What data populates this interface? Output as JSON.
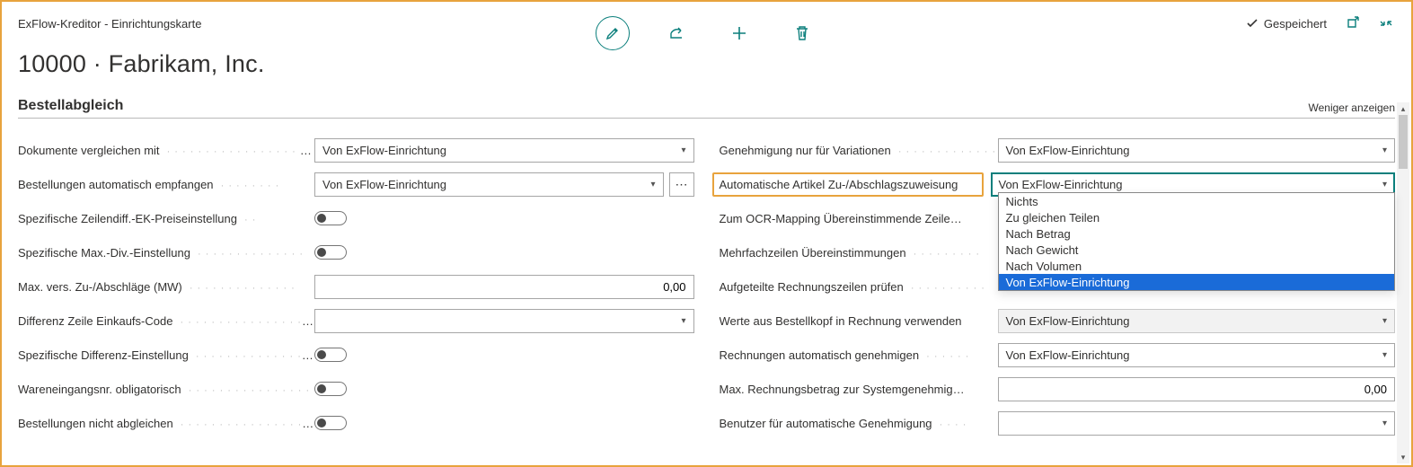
{
  "colors": {
    "accent": "#0b7f7c",
    "highlight": "#e8a33d",
    "selection": "#1a6bd8"
  },
  "header": {
    "breadcrumb": "ExFlow-Kreditor - Einrichtungskarte",
    "title": "10000 · Fabrikam, Inc.",
    "saved_label": "Gespeichert"
  },
  "section": {
    "title": "Bestellabgleich",
    "less_label": "Weniger anzeigen"
  },
  "left": {
    "f1": {
      "label": "Dokumente vergleichen mit",
      "value": "Von ExFlow-Einrichtung"
    },
    "f2": {
      "label": "Bestellungen automatisch empfangen",
      "value": "Von ExFlow-Einrichtung"
    },
    "f3": {
      "label": "Spezifische Zeilendiff.-EK-Preiseinstellung"
    },
    "f4": {
      "label": "Spezifische Max.-Div.-Einstellung"
    },
    "f5": {
      "label": "Max. vers. Zu-/Abschläge (MW)",
      "value": "0,00"
    },
    "f6": {
      "label": "Differenz Zeile Einkaufs-Code",
      "value": ""
    },
    "f7": {
      "label": "Spezifische Differenz-Einstellung"
    },
    "f8": {
      "label": "Wareneingangsnr. obligatorisch"
    },
    "f9": {
      "label": "Bestellungen nicht abgleichen"
    }
  },
  "right": {
    "f1": {
      "label": "Genehmigung nur für Variationen",
      "value": "Von ExFlow-Einrichtung"
    },
    "f2": {
      "label": "Automatische Artikel Zu-/Abschlagszuweisung",
      "value": "Von ExFlow-Einrichtung"
    },
    "f3": {
      "label": "Zum OCR-Mapping Übereinstimmende Zeile…"
    },
    "f4": {
      "label": "Mehrfachzeilen Übereinstimmungen"
    },
    "f5": {
      "label": "Aufgeteilte Rechnungszeilen prüfen"
    },
    "f6": {
      "label": "Werte aus Bestellkopf in Rechnung verwenden",
      "value": "Von ExFlow-Einrichtung"
    },
    "f7": {
      "label": "Rechnungen automatisch genehmigen",
      "value": "Von ExFlow-Einrichtung"
    },
    "f8": {
      "label": "Max. Rechnungsbetrag zur Systemgenehmig…",
      "value": "0,00"
    },
    "f9": {
      "label": "Benutzer für automatische Genehmigung",
      "value": ""
    }
  },
  "dropdown": {
    "options": [
      "Nichts",
      "Zu gleichen Teilen",
      "Nach Betrag",
      "Nach Gewicht",
      "Nach Volumen",
      "Von ExFlow-Einrichtung"
    ],
    "selected_index": 5
  }
}
